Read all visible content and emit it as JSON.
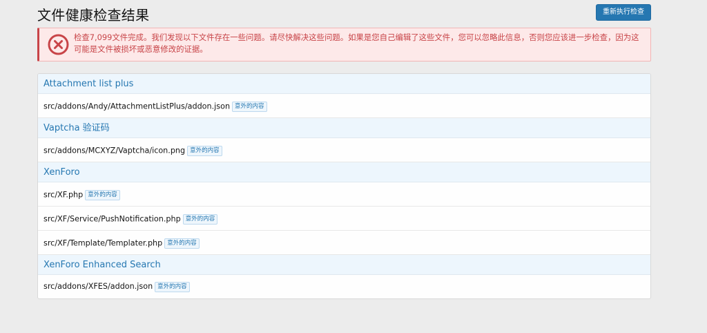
{
  "header": {
    "title": "文件健康检查结果",
    "rerun_button": "重新执行检查"
  },
  "alert": {
    "icon": "error-x-icon",
    "color": "#c84448",
    "message": "检查7,099文件完成。我们发现以下文件存在一些问题。请尽快解决这些问题。如果是您自己编辑了这些文件，您可以忽略此信息，否则您应该进一步检查，因为这可能是文件被损坏或恶意修改的证据。"
  },
  "groups": [
    {
      "title": "Attachment list plus",
      "files": [
        {
          "path": "src/addons/Andy/AttachmentListPlus/addon.json",
          "badge": "意外的内容"
        }
      ]
    },
    {
      "title": "Vaptcha 验证码",
      "files": [
        {
          "path": "src/addons/MCXYZ/Vaptcha/icon.png",
          "badge": "意外的内容"
        }
      ]
    },
    {
      "title": "XenForo",
      "files": [
        {
          "path": "src/XF.php",
          "badge": "意外的内容"
        },
        {
          "path": "src/XF/Service/PushNotification.php",
          "badge": "意外的内容"
        },
        {
          "path": "src/XF/Template/Templater.php",
          "badge": "意外的内容"
        }
      ]
    },
    {
      "title": "XenForo Enhanced Search",
      "files": [
        {
          "path": "src/addons/XFES/addon.json",
          "badge": "意外的内容"
        }
      ]
    }
  ]
}
